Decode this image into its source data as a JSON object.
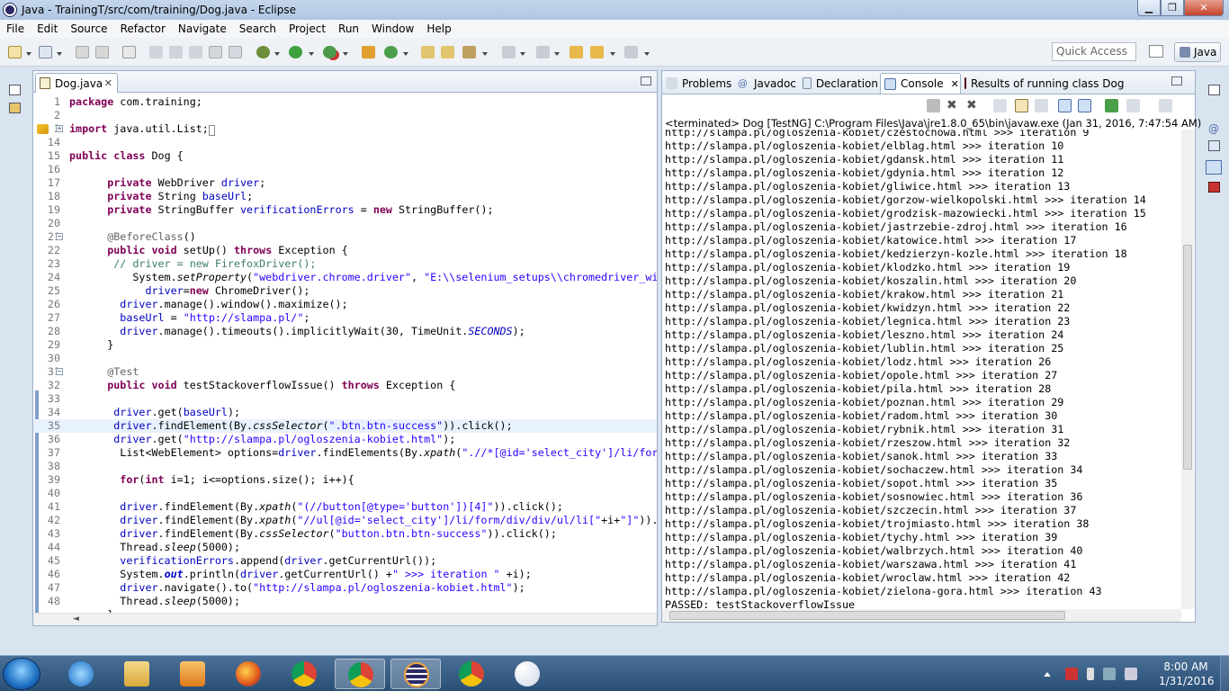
{
  "window": {
    "title": "Java - TrainingT/src/com/training/Dog.java - Eclipse"
  },
  "menu": [
    "File",
    "Edit",
    "Source",
    "Refactor",
    "Navigate",
    "Search",
    "Project",
    "Run",
    "Window",
    "Help"
  ],
  "toolbar": {
    "quick_access": "Quick Access",
    "perspective": "Java"
  },
  "editor": {
    "tab": "Dog.java",
    "lines": [
      {
        "n": "1",
        "html": "<span class='kw'>package</span> com.training;"
      },
      {
        "n": "2",
        "html": ""
      },
      {
        "n": "3",
        "html": "<span class='kw'>import</span> java.util.List;<span style='border:1px solid #888;font-size:9px'>&nbsp;</span>"
      },
      {
        "n": "14",
        "html": ""
      },
      {
        "n": "15",
        "html": "<span class='kw'>public</span> <span class='kw'>class</span> Dog {"
      },
      {
        "n": "16",
        "html": ""
      },
      {
        "n": "17",
        "html": "      <span class='kw'>private</span> WebDriver <span class='fld'>driver</span>;"
      },
      {
        "n": "18",
        "html": "      <span class='kw'>private</span> String <span class='fld'>baseUrl</span>;"
      },
      {
        "n": "19",
        "html": "      <span class='kw'>private</span> StringBuffer <span class='fld'>verificationErrors</span> = <span class='kw'>new</span> StringBuffer();"
      },
      {
        "n": "20",
        "html": ""
      },
      {
        "n": "21",
        "html": "      <span class='ann'>@BeforeClass</span>()"
      },
      {
        "n": "22",
        "html": "      <span class='kw'>public</span> <span class='kw'>void</span> setUp() <span class='kw'>throws</span> Exception {"
      },
      {
        "n": "23",
        "html": "       <span class='cm'>// driver = new FirefoxDriver();</span>"
      },
      {
        "n": "24",
        "html": "          System.<span class='it'>setProperty</span>(<span class='str'>\"webdriver.chrome.driver\"</span>, <span class='str'>\"E:\\\\selenium_setups\\\\chromedriver_win</span>"
      },
      {
        "n": "25",
        "html": "            <span class='fld'>driver</span>=<span class='kw'>new</span> ChromeDriver();"
      },
      {
        "n": "26",
        "html": "        <span class='fld'>driver</span>.manage().window().maximize();"
      },
      {
        "n": "27",
        "html": "        <span class='fld'>baseUrl</span> = <span class='str'>\"http://slampa.pl/\"</span>;"
      },
      {
        "n": "28",
        "html": "        <span class='fld'>driver</span>.manage().timeouts().implicitlyWait(30, TimeUnit.<span class='stat'>SECONDS</span>);"
      },
      {
        "n": "29",
        "html": "      }"
      },
      {
        "n": "30",
        "html": ""
      },
      {
        "n": "31",
        "html": "      <span class='ann'>@Test</span>"
      },
      {
        "n": "32",
        "html": "      <span class='kw'>public</span> <span class='kw'>void</span> testStackoverflowIssue() <span class='kw'>throws</span> Exception {"
      },
      {
        "n": "33",
        "html": ""
      },
      {
        "n": "34",
        "html": "       <span class='fld'>driver</span>.get(<span class='fld'>baseUrl</span>);"
      },
      {
        "n": "35",
        "html": "       <span class='fld'>driver</span>.findElement(By.<span class='it'>cssSelector</span>(<span class='str'>\".btn.btn-success\"</span>)).click();"
      },
      {
        "n": "36",
        "html": "       <span class='fld'>driver</span>.get(<span class='str'>\"http://slampa.pl/ogloszenia-kobiet.html\"</span>);"
      },
      {
        "n": "37",
        "html": "        List&lt;WebElement&gt; options=<span class='fld'>driver</span>.findElements(By.<span class='it'>xpath</span>(<span class='str'>\".//*[@id='select_city']/li/form</span>"
      },
      {
        "n": "38",
        "html": ""
      },
      {
        "n": "39",
        "html": "        <span class='kw'>for</span>(<span class='kw'>int</span> i=1; i&lt;=options.size(); i++){"
      },
      {
        "n": "40",
        "html": ""
      },
      {
        "n": "41",
        "html": "        <span class='fld'>driver</span>.findElement(By.<span class='it'>xpath</span>(<span class='str'>\"(//button[@type='button'])[4]\"</span>)).click();"
      },
      {
        "n": "42",
        "html": "        <span class='fld'>driver</span>.findElement(By.<span class='it'>xpath</span>(<span class='str'>\"//ul[@id='select_city']/li/form/div/div/ul/li[\"</span>+i+<span class='str'>\"]\"</span>))."
      },
      {
        "n": "43",
        "html": "        <span class='fld'>driver</span>.findElement(By.<span class='it'>cssSelector</span>(<span class='str'>\"button.btn.btn-success\"</span>)).click();"
      },
      {
        "n": "44",
        "html": "        Thread.<span class='it'>sleep</span>(5000);"
      },
      {
        "n": "45",
        "html": "        <span class='fld'>verificationErrors</span>.append(<span class='fld'>driver</span>.getCurrentUrl());"
      },
      {
        "n": "46",
        "html": "        System.<span class='stat' style='font-weight:bold'>out</span>.println(<span class='fld'>driver</span>.getCurrentUrl() +<span class='str'>\" &gt;&gt;&gt; iteration \"</span> +i);"
      },
      {
        "n": "47",
        "html": "        <span class='fld'>driver</span>.navigate().to(<span class='str'>\"http://slampa.pl/ogloszenia-kobiet.html\"</span>);"
      },
      {
        "n": "48",
        "html": "        Thread.<span class='it'>sleep</span>(5000);"
      },
      {
        "n": "",
        "html": "      }"
      }
    ]
  },
  "console": {
    "tabs": [
      "Problems",
      "Javadoc",
      "Declaration",
      "Console",
      "Results of running class Dog"
    ],
    "status": "<terminated> Dog [TestNG] C:\\Program Files\\Java\\jre1.8.0_65\\bin\\javaw.exe (Jan 31, 2016, 7:47:54 AM)",
    "lines": [
      "http://slampa.pl/ogloszenia-kobiet/czestochowa.html >>> iteration 9",
      "http://slampa.pl/ogloszenia-kobiet/elblag.html >>> iteration 10",
      "http://slampa.pl/ogloszenia-kobiet/gdansk.html >>> iteration 11",
      "http://slampa.pl/ogloszenia-kobiet/gdynia.html >>> iteration 12",
      "http://slampa.pl/ogloszenia-kobiet/gliwice.html >>> iteration 13",
      "http://slampa.pl/ogloszenia-kobiet/gorzow-wielkopolski.html >>> iteration 14",
      "http://slampa.pl/ogloszenia-kobiet/grodzisk-mazowiecki.html >>> iteration 15",
      "http://slampa.pl/ogloszenia-kobiet/jastrzebie-zdroj.html >>> iteration 16",
      "http://slampa.pl/ogloszenia-kobiet/katowice.html >>> iteration 17",
      "http://slampa.pl/ogloszenia-kobiet/kedzierzyn-kozle.html >>> iteration 18",
      "http://slampa.pl/ogloszenia-kobiet/klodzko.html >>> iteration 19",
      "http://slampa.pl/ogloszenia-kobiet/koszalin.html >>> iteration 20",
      "http://slampa.pl/ogloszenia-kobiet/krakow.html >>> iteration 21",
      "http://slampa.pl/ogloszenia-kobiet/kwidzyn.html >>> iteration 22",
      "http://slampa.pl/ogloszenia-kobiet/legnica.html >>> iteration 23",
      "http://slampa.pl/ogloszenia-kobiet/leszno.html >>> iteration 24",
      "http://slampa.pl/ogloszenia-kobiet/lublin.html >>> iteration 25",
      "http://slampa.pl/ogloszenia-kobiet/lodz.html >>> iteration 26",
      "http://slampa.pl/ogloszenia-kobiet/opole.html >>> iteration 27",
      "http://slampa.pl/ogloszenia-kobiet/pila.html >>> iteration 28",
      "http://slampa.pl/ogloszenia-kobiet/poznan.html >>> iteration 29",
      "http://slampa.pl/ogloszenia-kobiet/radom.html >>> iteration 30",
      "http://slampa.pl/ogloszenia-kobiet/rybnik.html >>> iteration 31",
      "http://slampa.pl/ogloszenia-kobiet/rzeszow.html >>> iteration 32",
      "http://slampa.pl/ogloszenia-kobiet/sanok.html >>> iteration 33",
      "http://slampa.pl/ogloszenia-kobiet/sochaczew.html >>> iteration 34",
      "http://slampa.pl/ogloszenia-kobiet/sopot.html >>> iteration 35",
      "http://slampa.pl/ogloszenia-kobiet/sosnowiec.html >>> iteration 36",
      "http://slampa.pl/ogloszenia-kobiet/szczecin.html >>> iteration 37",
      "http://slampa.pl/ogloszenia-kobiet/trojmiasto.html >>> iteration 38",
      "http://slampa.pl/ogloszenia-kobiet/tychy.html >>> iteration 39",
      "http://slampa.pl/ogloszenia-kobiet/walbrzych.html >>> iteration 40",
      "http://slampa.pl/ogloszenia-kobiet/warszawa.html >>> iteration 41",
      "http://slampa.pl/ogloszenia-kobiet/wroclaw.html >>> iteration 42",
      "http://slampa.pl/ogloszenia-kobiet/zielona-gora.html >>> iteration 43",
      "PASSED: testStackoverflowIssue"
    ]
  },
  "taskbar": {
    "time": "8:00 AM",
    "date": "1/31/2016"
  },
  "colors": {
    "keyword": "#7f0055",
    "string": "#2a00ff",
    "field": "#0000c0",
    "comment": "#3f7f5f"
  }
}
